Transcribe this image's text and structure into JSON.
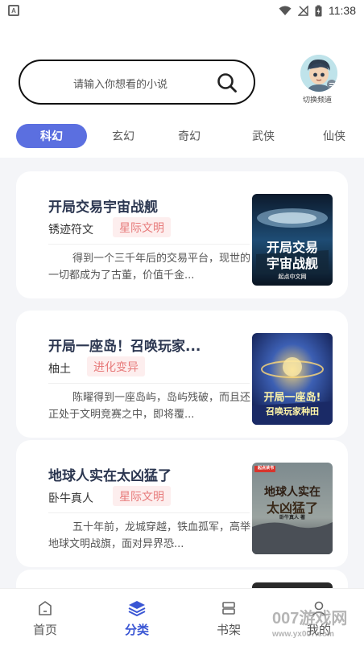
{
  "status_bar": {
    "time": "11:38"
  },
  "search": {
    "placeholder": "请输入你想看的小说"
  },
  "avatar": {
    "label": "切换频道"
  },
  "tabs": [
    {
      "label": "科幻",
      "active": true
    },
    {
      "label": "玄幻",
      "active": false
    },
    {
      "label": "奇幻",
      "active": false
    },
    {
      "label": "武侠",
      "active": false
    },
    {
      "label": "仙侠",
      "active": false
    }
  ],
  "books": [
    {
      "title": "开局交易宇宙战舰",
      "author": "锈迹符文",
      "tag": "星际文明",
      "description": "得到一个三千年后的交易平台，现世的一切都成为了古董，价值千金...",
      "cover_text": [
        "开局交易",
        "宇宙战舰"
      ],
      "cover_publisher": "起点中文网"
    },
    {
      "title": "开局一座岛！召唤玩家...",
      "author": "柚土",
      "tag": "进化变异",
      "description": "陈曜得到一座岛屿，岛屿残破，而且还正处于文明竞赛之中，即将覆...",
      "cover_text": [
        "开局一座岛!",
        "召唤玩家种田"
      ]
    },
    {
      "title": "地球人实在太凶猛了",
      "author": "卧牛真人",
      "tag": "星际文明",
      "description": "五十年前，龙城穿越，铁血孤军，高举地球文明战旗，面对异界恐...",
      "cover_text": [
        "地球人实在",
        "太凶猛了"
      ],
      "cover_badge": "起点读书",
      "cover_author": "卧牛真人 著"
    }
  ],
  "nav": [
    {
      "label": "首页",
      "icon": "home-icon",
      "active": false
    },
    {
      "label": "分类",
      "icon": "layers-icon",
      "active": true
    },
    {
      "label": "书架",
      "icon": "shelf-icon",
      "active": false
    },
    {
      "label": "我的",
      "icon": "user-icon",
      "active": false
    }
  ],
  "watermark": {
    "brand": "007游戏网",
    "url": "www.yx007.com"
  },
  "colors": {
    "accent": "#5b6fe0",
    "active_nav": "#3a56d4",
    "tag_bg": "#fdeeee",
    "tag_text": "#e77a7a"
  }
}
